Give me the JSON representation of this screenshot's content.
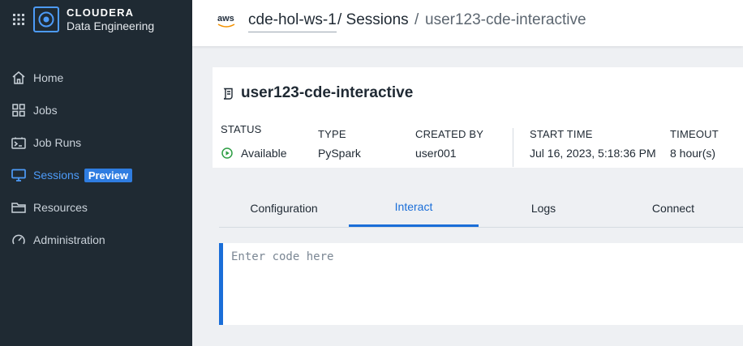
{
  "brand": {
    "name": "CLOUDERA",
    "product": "Data Engineering"
  },
  "colors": {
    "sidebar_bg": "#1f2a33",
    "accent": "#1a6ed8",
    "active_nav": "#4d9bf8",
    "status_green": "#2e9e44"
  },
  "sidebar": {
    "items": [
      {
        "label": "Home",
        "icon": "home-icon"
      },
      {
        "label": "Jobs",
        "icon": "grid-jobs-icon"
      },
      {
        "label": "Job Runs",
        "icon": "terminal-icon"
      },
      {
        "label": "Sessions",
        "icon": "monitor-icon",
        "active": true,
        "badge": "Preview"
      },
      {
        "label": "Resources",
        "icon": "folder-icon"
      },
      {
        "label": "Administration",
        "icon": "gauge-icon"
      }
    ]
  },
  "header": {
    "cloud_label": "aws",
    "workspace": "cde-hol-ws-1",
    "crumb_sessions": "/ Sessions",
    "crumb_sep": "/",
    "crumb_current": "user123-cde-interactive"
  },
  "session": {
    "title": "user123-cde-interactive",
    "fields": {
      "status_label": "STATUS",
      "status_value": "Available",
      "type_label": "TYPE",
      "type_value": "PySpark",
      "created_label": "CREATED BY",
      "created_value": "user001",
      "start_label": "START TIME",
      "start_value": "Jul 16, 2023, 5:18:36 PM",
      "timeout_label": "TIMEOUT",
      "timeout_value": "8 hour(s)"
    }
  },
  "tabs": [
    {
      "label": "Configuration"
    },
    {
      "label": "Interact",
      "active": true
    },
    {
      "label": "Logs"
    },
    {
      "label": "Connect"
    }
  ],
  "editor": {
    "placeholder": "Enter code here",
    "value": ""
  }
}
